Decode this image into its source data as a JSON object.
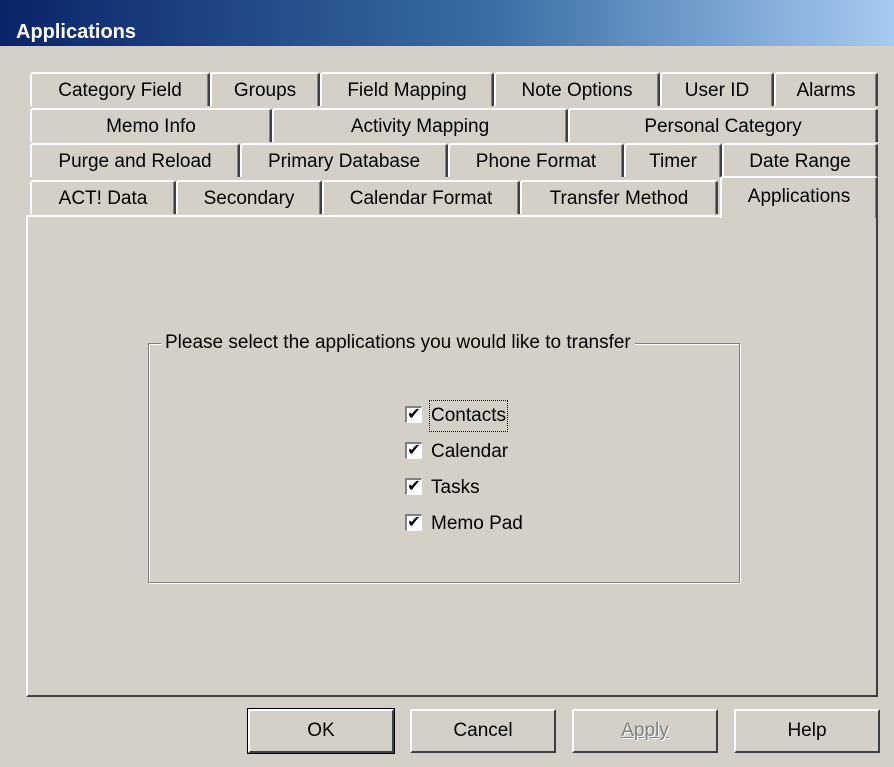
{
  "window": {
    "title": "Applications"
  },
  "tab_rows": [
    [
      "Category Field",
      "Groups",
      "Field Mapping",
      "Note Options",
      "User ID",
      "Alarms"
    ],
    [
      "Memo Info",
      "Activity Mapping",
      "Personal Category"
    ],
    [
      "Purge and Reload",
      "Primary Database",
      "Phone Format",
      "Timer",
      "Date Range"
    ],
    [
      "ACT! Data",
      "Secondary",
      "Calendar Format",
      "Transfer Method",
      "Applications"
    ]
  ],
  "active_tab": "Applications",
  "group": {
    "legend": "Please select the applications you would like to transfer",
    "options": [
      {
        "label": "Contacts",
        "checked": true
      },
      {
        "label": "Calendar",
        "checked": true
      },
      {
        "label": "Tasks",
        "checked": true
      },
      {
        "label": "Memo Pad",
        "checked": true
      }
    ]
  },
  "buttons": {
    "ok": "OK",
    "cancel": "Cancel",
    "apply": "Apply",
    "help": "Help"
  }
}
